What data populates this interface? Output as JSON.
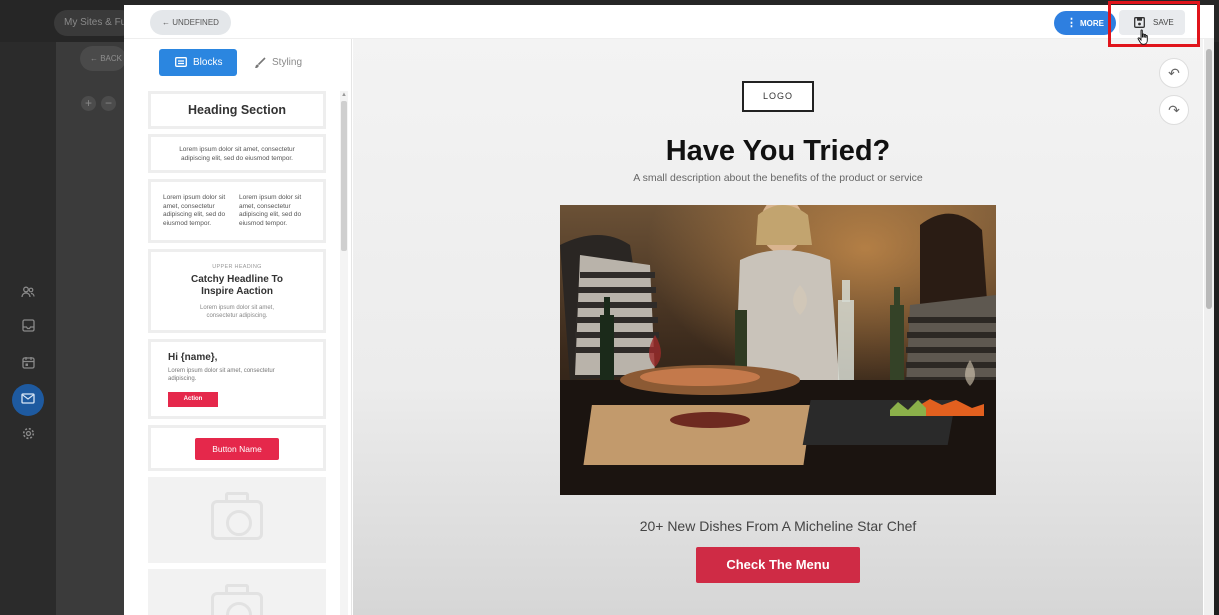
{
  "background_app": {
    "breadcrumb": "My Sites & Funnels",
    "back_label": "← BACK",
    "zoom_in": "+",
    "zoom_out": "−"
  },
  "toolbar": {
    "undefined_label": "← UNDEFINED",
    "more_label": "MORE",
    "more_icon": "⋮",
    "save_label": "SAVE"
  },
  "panel": {
    "tab_blocks": "Blocks",
    "tab_styling": "Styling",
    "blocks": {
      "heading": "Heading Section",
      "paragraph": "Lorem ipsum dolor sit amet, consectetur adipiscing elit, sed do eiusmod tempor.",
      "col_left": "Lorem ipsum dolor sit amet, consectetur adipiscing elit, sed do eiusmod tempor.",
      "col_right": "Lorem ipsum dolor sit amet, consectetur adipiscing elit, sed do eiusmod tempor.",
      "upper_heading": "UPPER HEADING",
      "catchy": "Catchy Headline To Inspire Aaction",
      "catchy_sub": "Lorem ipsum dolor sit amet, consectetur adipiscing.",
      "hi_name": "Hi {name},",
      "hi_text": "Lorem ipsum dolor sit amet, consectetur adipiscing.",
      "action_label": "Action",
      "button_name": "Button Name"
    }
  },
  "canvas": {
    "logo": "LOGO",
    "headline": "Have You Tried?",
    "subdesc": "A small description about the benefits of the product or service",
    "tagline": "20+ New Dishes From A Micheline Star Chef",
    "cta": "Check The Menu",
    "undo_icon": "↶",
    "redo_icon": "↷"
  },
  "colors": {
    "primary_blue": "#2b86e0",
    "cta_red": "#cf2b45",
    "highlight_red": "#e0141b"
  }
}
